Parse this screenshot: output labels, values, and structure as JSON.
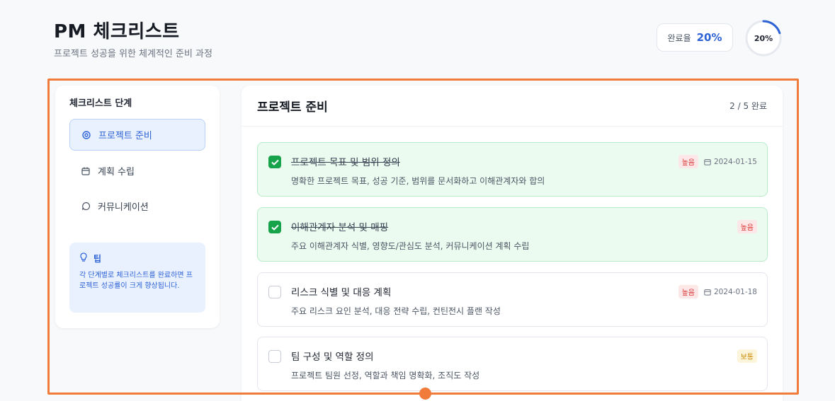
{
  "header": {
    "title": "PM 체크리스트",
    "subtitle": "프로젝트 성공을 위한 체계적인 준비 과정"
  },
  "progress": {
    "label": "완료율",
    "value": "20%",
    "ring_text": "20%",
    "fraction": 0.2,
    "color": "#2e63d6"
  },
  "sidebar": {
    "title": "체크리스트 단계",
    "items": [
      {
        "label": "프로젝트 준비",
        "icon": "gear-icon",
        "active": true
      },
      {
        "label": "계획 수립",
        "icon": "calendar-icon",
        "active": false
      },
      {
        "label": "커뮤니케이션",
        "icon": "chat-bubble-icon",
        "active": false
      }
    ],
    "tip": {
      "title": "팁",
      "icon": "lightbulb-icon",
      "text": "각 단계별로 체크리스트를 완료하면 프로젝트 성공률이 크게 향상됩니다."
    }
  },
  "main": {
    "title": "프로젝트 준비",
    "count": "2 / 5 완료",
    "tasks": [
      {
        "title": "프로젝트 목표 및 범위 정의",
        "desc": "명확한 프로젝트 목표, 성공 기준, 범위를 문서화하고 이해관계자와 합의",
        "priority": "높음",
        "date": "2024-01-15",
        "done": true
      },
      {
        "title": "이해관계자 분석 및 매핑",
        "desc": "주요 이해관계자 식별, 영향도/관심도 분석, 커뮤니케이션 계획 수립",
        "priority": "높음",
        "date": "",
        "done": true
      },
      {
        "title": "리스크 식별 및 대응 계획",
        "desc": "주요 리스크 요인 분석, 대응 전략 수립, 컨틴전시 플랜 작성",
        "priority": "높음",
        "date": "2024-01-18",
        "done": false
      },
      {
        "title": "팀 구성 및 역할 정의",
        "desc": "프로젝트 팀원 선정, 역할과 책임 명확화, 조직도 작성",
        "priority": "보통",
        "date": "",
        "done": false
      }
    ]
  },
  "colors": {
    "accent": "#2e63d6",
    "done_bg": "#ecfbf0",
    "done_check": "#16a34a",
    "priority_high": "#d93636",
    "priority_mid": "#c98a00",
    "highlight": "#f07b3a"
  }
}
